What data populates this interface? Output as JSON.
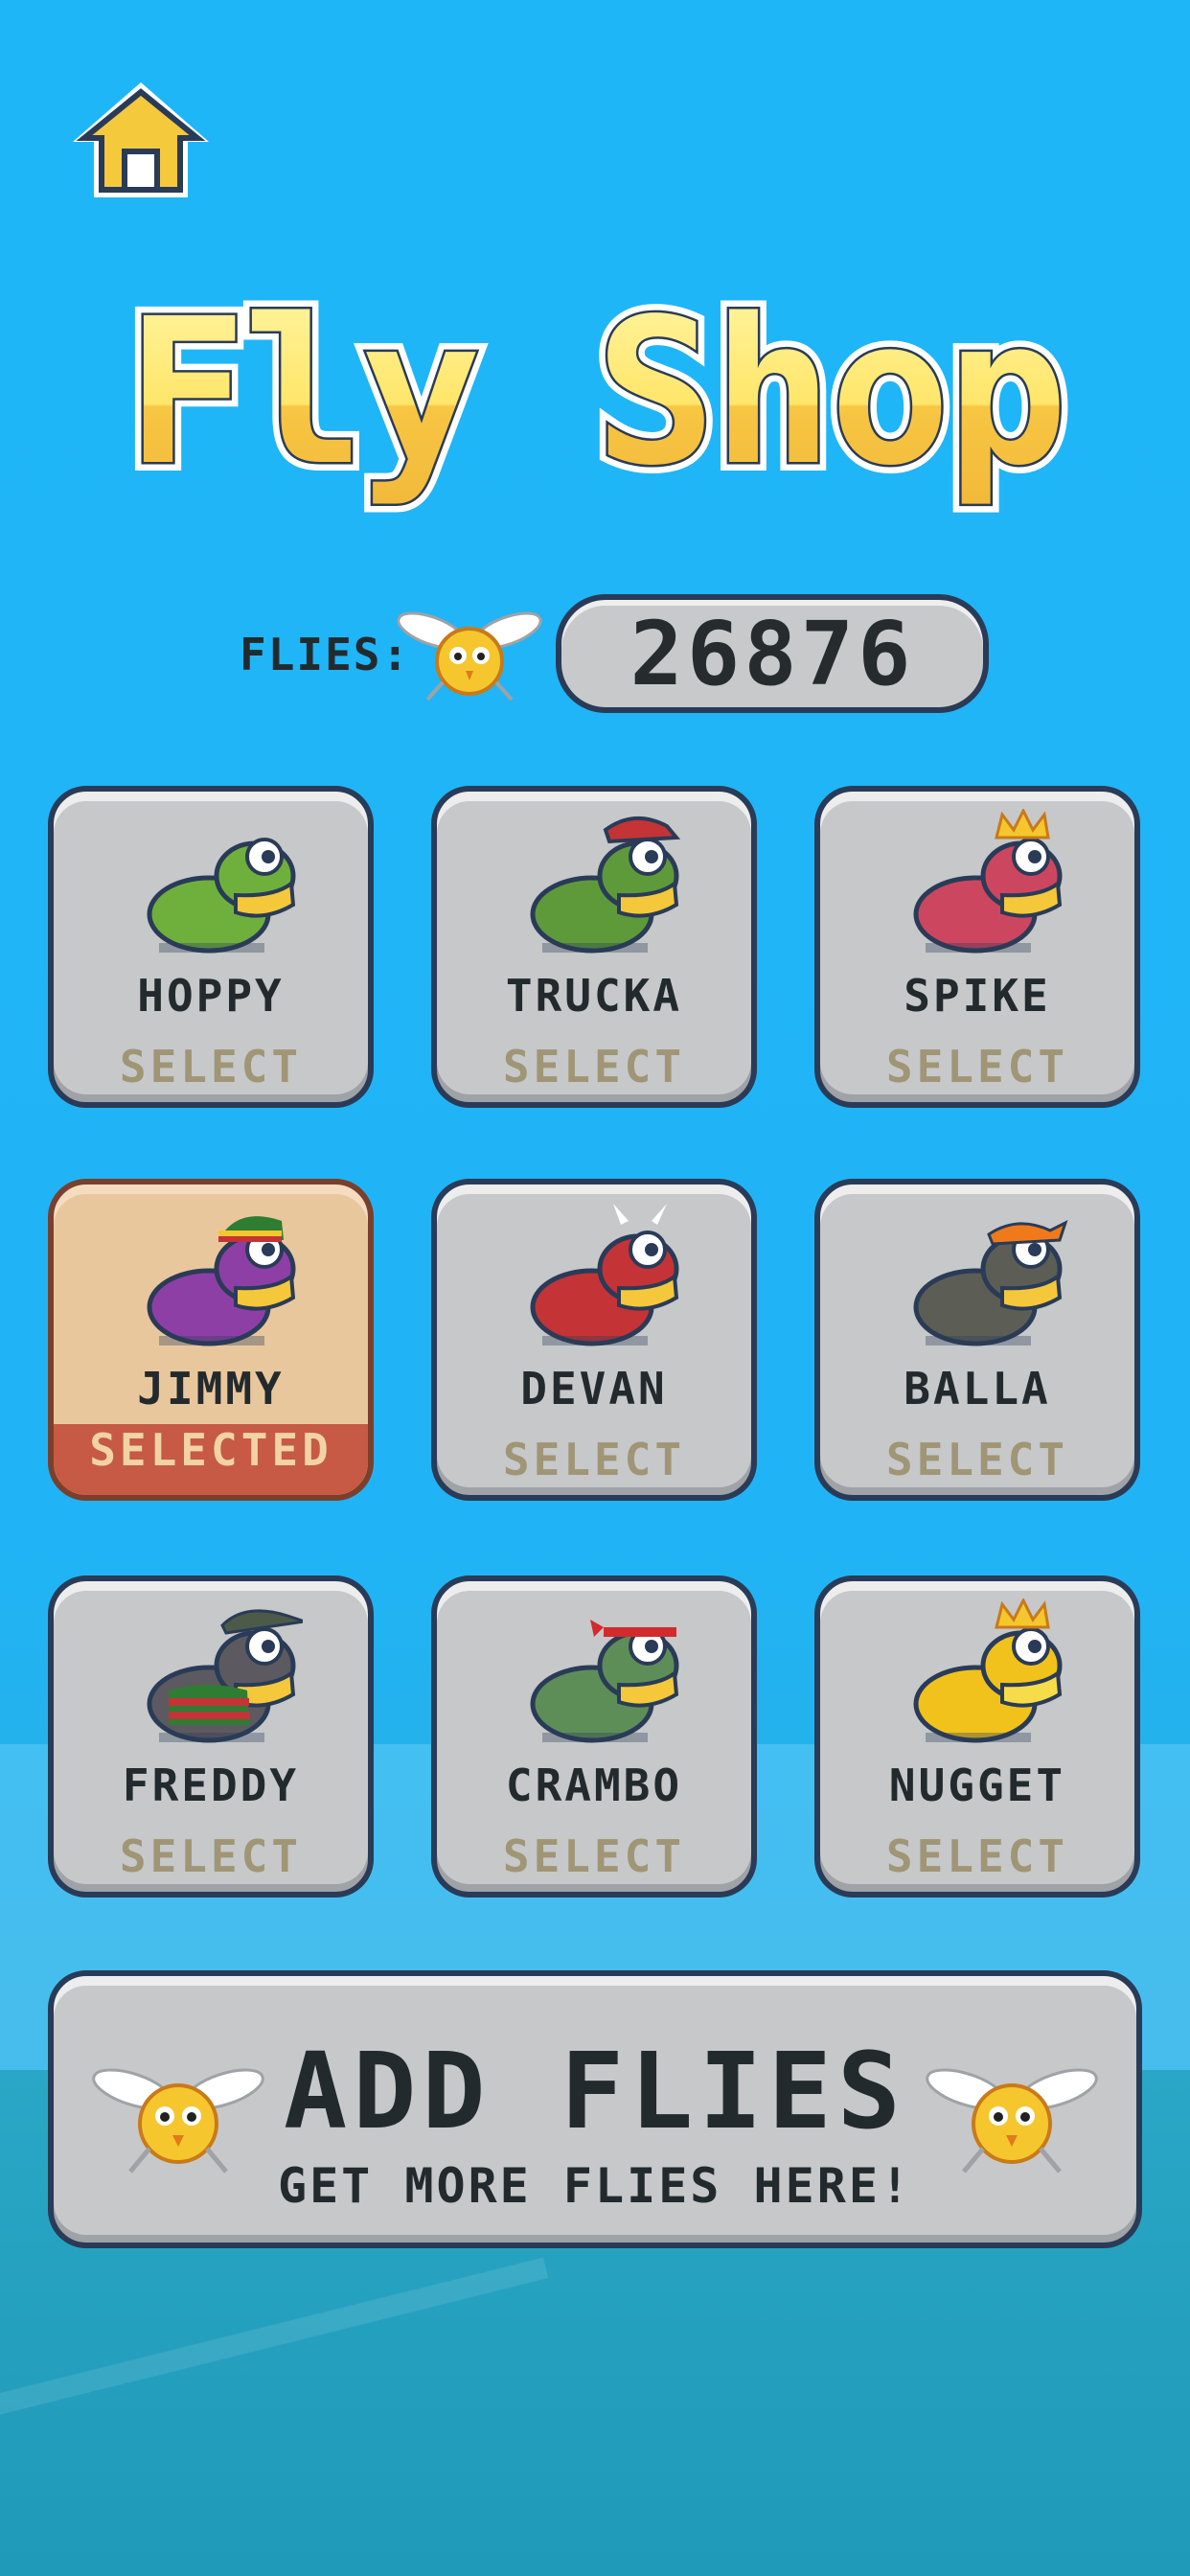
{
  "title": "Fly Shop",
  "flies": {
    "label": "FLIES:",
    "count": "26876"
  },
  "frogs": [
    {
      "name": "HOPPY",
      "action": "SELECT",
      "selected": false,
      "body": "#6fb03c",
      "belly": "#f4c83a",
      "accent": "none"
    },
    {
      "name": "TRUCKA",
      "action": "SELECT",
      "selected": false,
      "body": "#5f9a3a",
      "belly": "#f4c83a",
      "accent": "cap"
    },
    {
      "name": "SPIKE",
      "action": "SELECT",
      "selected": false,
      "body": "#cd4660",
      "belly": "#f4c83a",
      "accent": "crown"
    },
    {
      "name": "JIMMY",
      "action": "SELECTED",
      "selected": true,
      "body": "#8e3fa6",
      "belly": "#f4c83a",
      "accent": "rasta"
    },
    {
      "name": "DEVAN",
      "action": "SELECT",
      "selected": false,
      "body": "#c43336",
      "belly": "#f4c83a",
      "accent": "horns"
    },
    {
      "name": "BALLA",
      "action": "SELECT",
      "selected": false,
      "body": "#5c5e56",
      "belly": "#f4c83a",
      "accent": "bandana"
    },
    {
      "name": "FREDDY",
      "action": "SELECT",
      "selected": false,
      "body": "#5c5a60",
      "belly": "#f4c83a",
      "accent": "sweater"
    },
    {
      "name": "CRAMBO",
      "action": "SELECT",
      "selected": false,
      "body": "#5d8e58",
      "belly": "#f4c83a",
      "accent": "headband"
    },
    {
      "name": "NUGGET",
      "action": "SELECT",
      "selected": false,
      "body": "#f2c21c",
      "belly": "#f7dc4a",
      "accent": "crown"
    }
  ],
  "add_flies": {
    "title": "ADD FLIES",
    "subtitle": "GET MORE FLIES  HERE!"
  },
  "colors": {
    "sky": "#20b4f6",
    "card_bg": "#c6c8ca",
    "card_border": "#2a3b57",
    "selected_bg": "#e9c79d",
    "selected_bar": "#c75a44",
    "title_yellow": "#ffe66a"
  }
}
